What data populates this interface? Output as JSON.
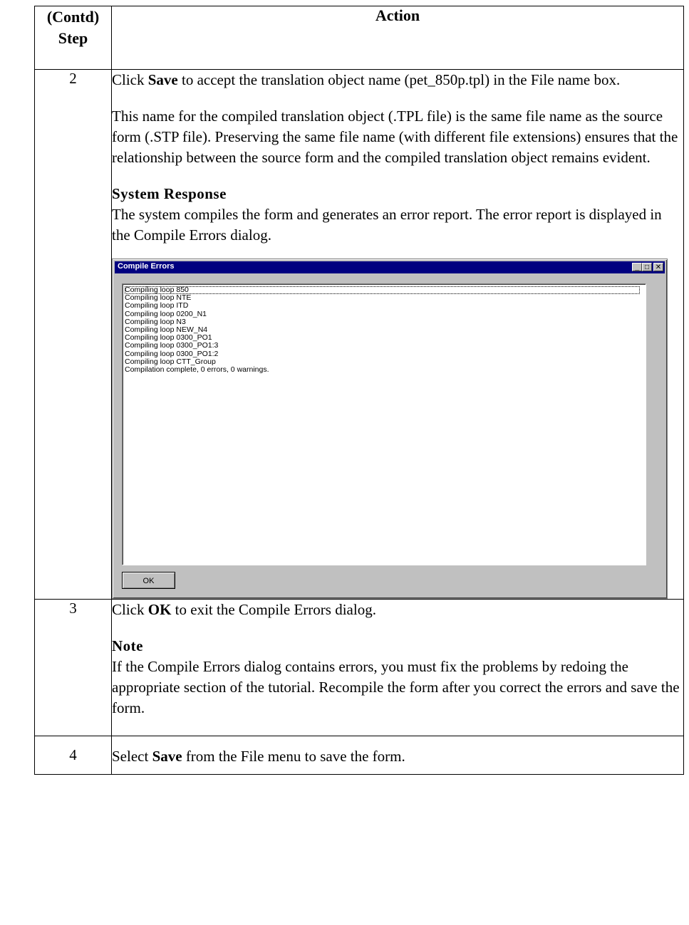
{
  "table": {
    "header": {
      "step_line1": "(Contd)",
      "step_line2": "Step",
      "action": "Action"
    },
    "rows": [
      {
        "step": "2",
        "para1_pre": "Click ",
        "para1_bold": "Save",
        "para1_post": " to accept the translation object name (pet_850p.tpl) in the File name box.",
        "para2": "This name for the compiled translation object (.TPL file) is the same file name as the source form (.STP file). Preserving the same file name (with different file extensions) ensures that the relationship between the source form and the compiled translation object remains evident.",
        "subhead": "System Response",
        "subbody": "The system compiles the form and generates an error report. The error report is displayed in the Compile Errors dialog."
      },
      {
        "step": "3",
        "para1_pre": "Click ",
        "para1_bold": "OK",
        "para1_post": " to exit the Compile Errors dialog.",
        "subhead": "Note",
        "subbody": "If the Compile Errors dialog contains errors, you must fix the problems by redoing the appropriate section of the tutorial. Recompile the form after you correct the errors and save the form."
      },
      {
        "step": "4",
        "para1_pre": "Select ",
        "para1_bold": "Save",
        "para1_post": " from the File menu to save the form."
      }
    ]
  },
  "dialog": {
    "title": "Compile Errors",
    "title_buttons": {
      "minimize": "_",
      "maximize": "□",
      "close": "✕"
    },
    "lines": [
      "Compiling loop 850",
      "Compiling loop NTE",
      "Compiling loop ITD",
      "Compiling loop 0200_N1",
      "Compiling loop N3",
      "Compiling loop NEW_N4",
      "Compiling loop 0300_PO1",
      "Compiling loop 0300_PO1:3",
      "Compiling loop 0300_PO1:2",
      "Compiling loop CTT_Group",
      "Compilation complete, 0 errors, 0 warnings."
    ],
    "ok_label": "OK"
  }
}
